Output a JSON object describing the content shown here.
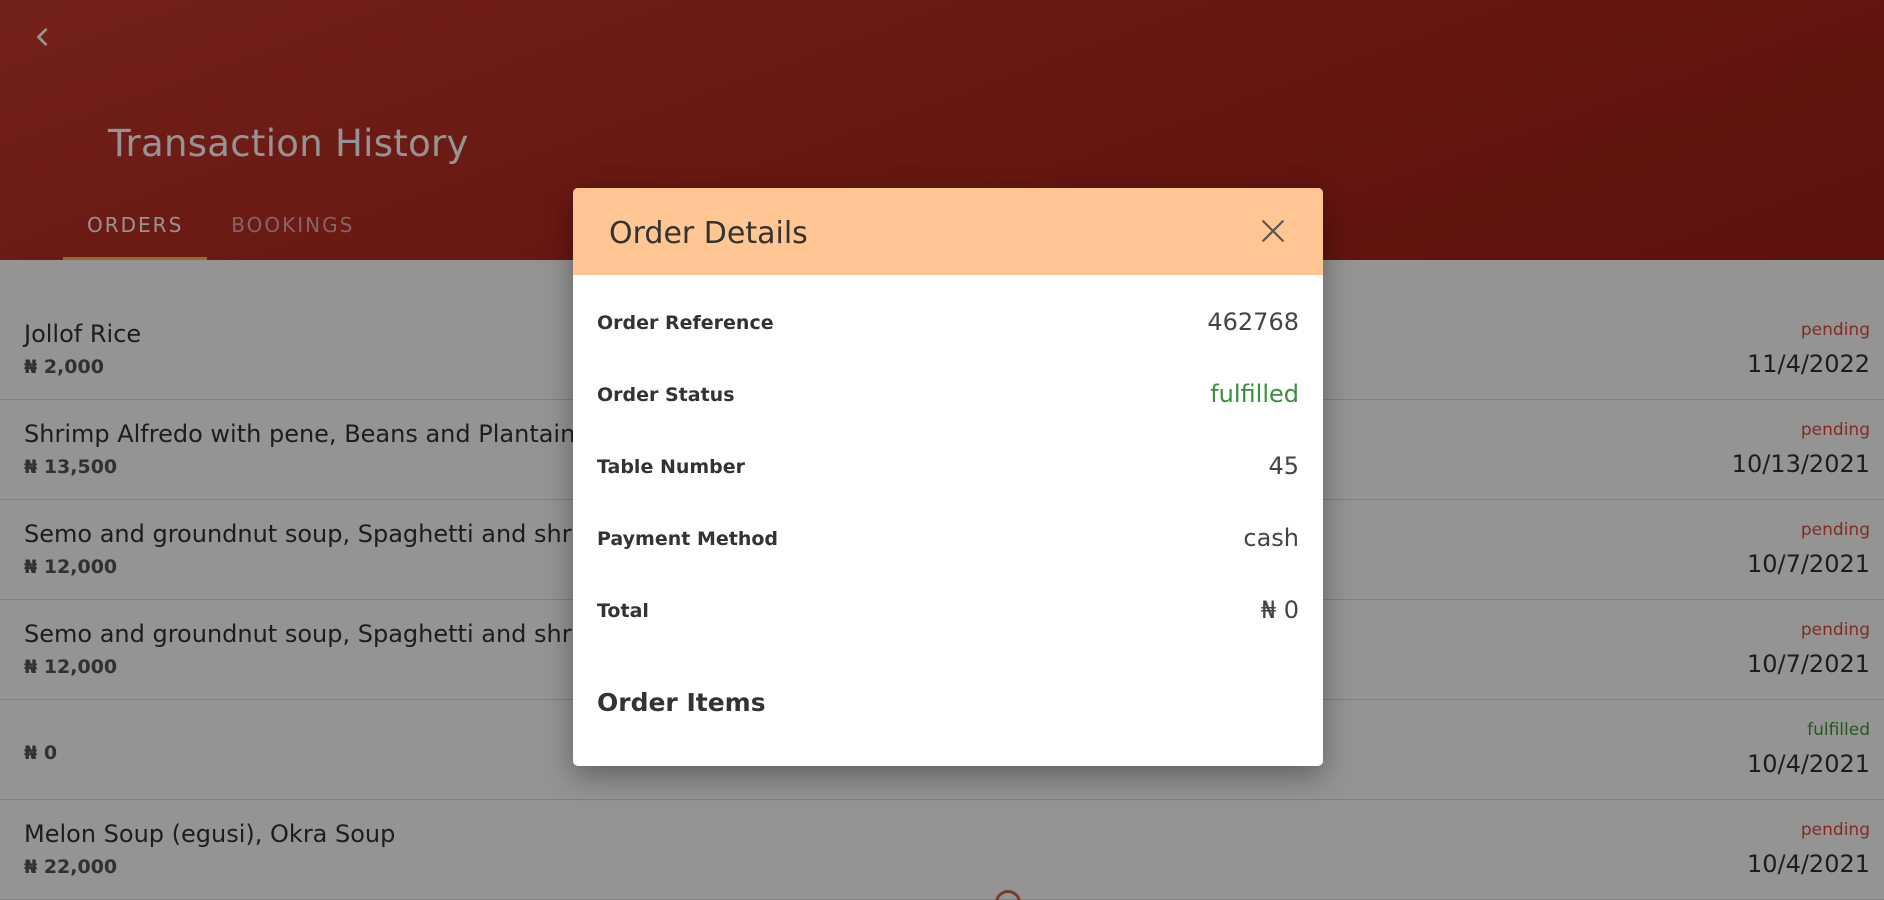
{
  "header": {
    "title": "Transaction History",
    "tabs": [
      {
        "label": "ORDERS"
      },
      {
        "label": "BOOKINGS"
      }
    ]
  },
  "orders": [
    {
      "name": "Jollof Rice",
      "price": "₦ 2,000",
      "status": "pending",
      "date": "11/4/2022"
    },
    {
      "name": "Shrimp Alfredo with pene, Beans and Plantain",
      "price": "₦ 13,500",
      "status": "pending",
      "date": "10/13/2021"
    },
    {
      "name": "Semo and groundnut soup, Spaghetti and shrimp",
      "price": "₦ 12,000",
      "status": "pending",
      "date": "10/7/2021"
    },
    {
      "name": "Semo and groundnut soup, Spaghetti and shrimp",
      "price": "₦ 12,000",
      "status": "pending",
      "date": "10/7/2021"
    },
    {
      "name": "",
      "price": "₦ 0",
      "status": "fulfilled",
      "date": "10/4/2021"
    },
    {
      "name": "Melon Soup (egusi), Okra Soup",
      "price": "₦ 22,000",
      "status": "pending",
      "date": "10/4/2021"
    }
  ],
  "modal": {
    "title": "Order Details",
    "details": [
      {
        "label": "Order Reference",
        "value": "462768"
      },
      {
        "label": "Order Status",
        "value": "fulfilled"
      },
      {
        "label": "Table Number",
        "value": "45"
      },
      {
        "label": "Payment Method",
        "value": "cash"
      },
      {
        "label": "Total",
        "value": "₦ 0"
      }
    ],
    "items_heading": "Order Items"
  },
  "colors": {
    "header": "#b52a20",
    "tab_indicator": "#f4c24d",
    "modal_header": "#ffc593",
    "pending": "#e04a3a",
    "fulfilled": "#3a9a3a"
  },
  "icons": {
    "back": "chevron-left-icon",
    "close": "close-icon",
    "bottom": "circle-icon"
  }
}
